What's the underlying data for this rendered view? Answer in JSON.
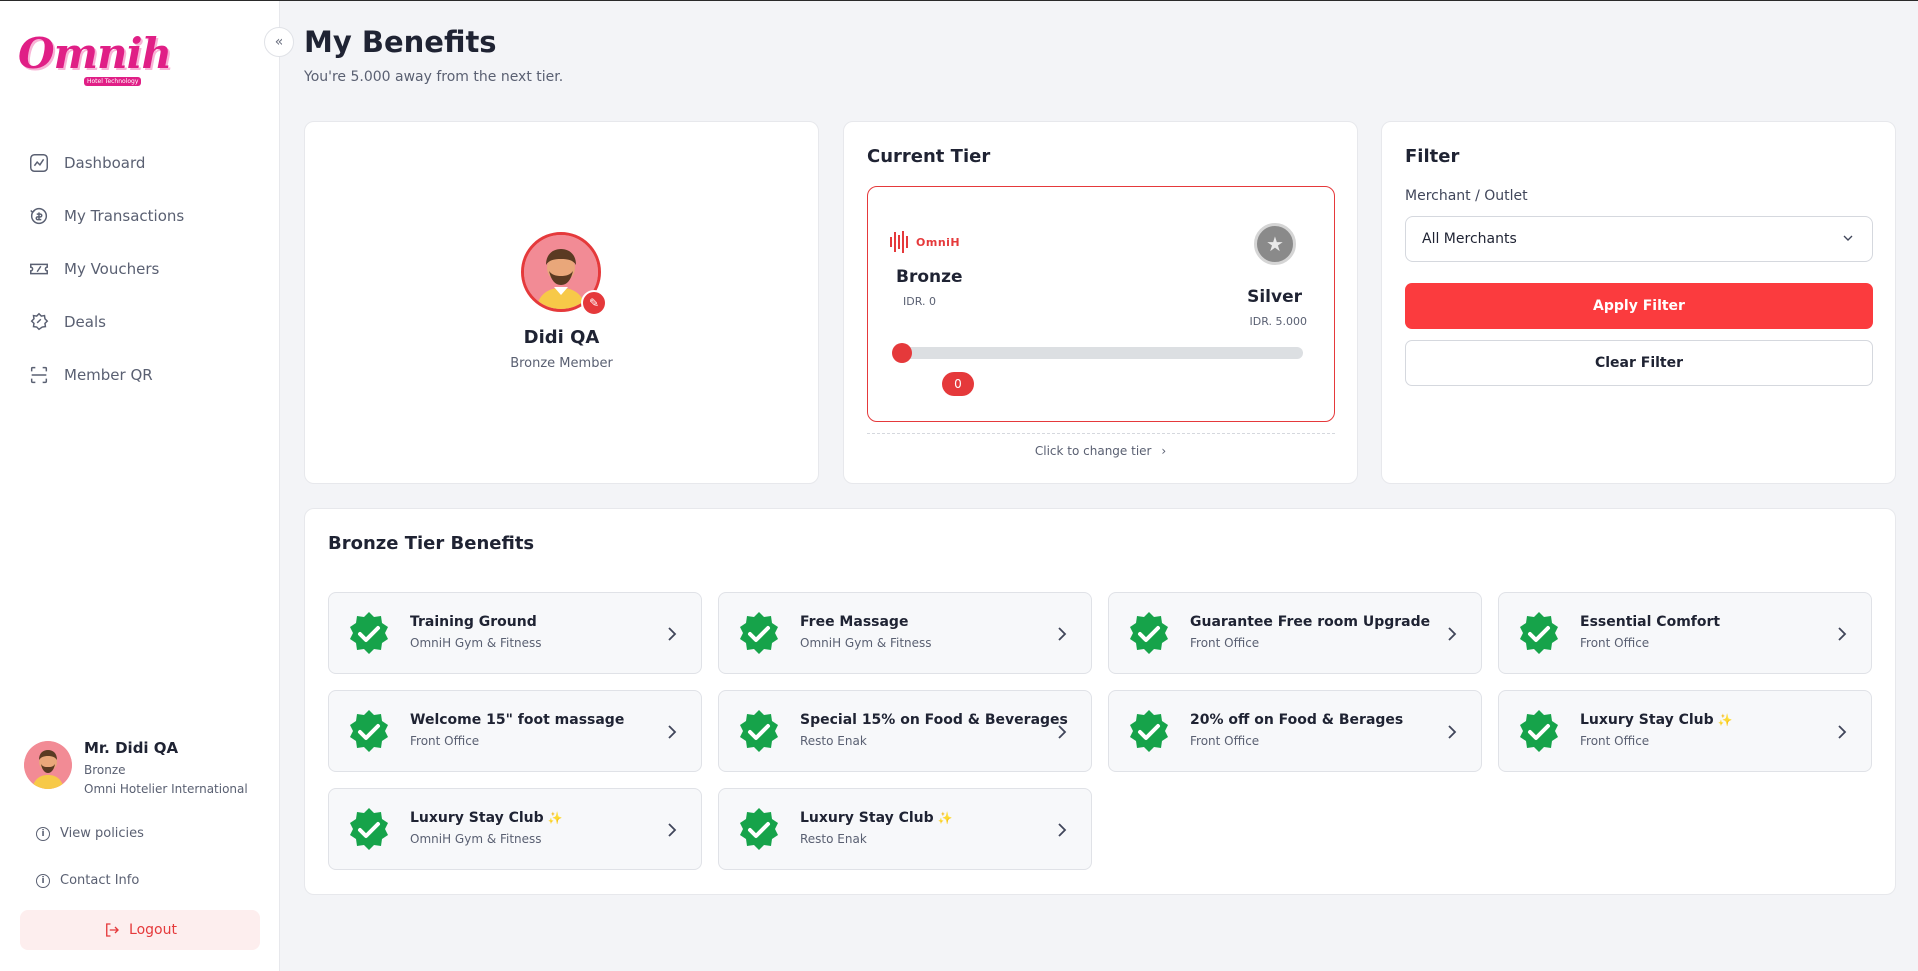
{
  "app": {
    "logo_text": "Omnih",
    "logo_subtext": "Hotel Technology",
    "collapse_label": "«"
  },
  "sidebar": {
    "nav": [
      {
        "label": "Dashboard",
        "icon": "chart-line-icon"
      },
      {
        "label": "My Transactions",
        "icon": "transactions-icon"
      },
      {
        "label": "My Vouchers",
        "icon": "voucher-icon"
      },
      {
        "label": "Deals",
        "icon": "deals-icon"
      },
      {
        "label": "Member QR",
        "icon": "qr-scan-icon"
      }
    ],
    "user": {
      "name": "Mr. Didi QA",
      "tier": "Bronze",
      "organization": "Omni Hotelier International"
    },
    "links": {
      "policies": "View policies",
      "contact": "Contact Info"
    },
    "logout_label": "Logout"
  },
  "header": {
    "title": "My Benefits",
    "subtitle": "You're 5.000 away from the next tier."
  },
  "profile": {
    "name": "Didi QA",
    "member_tier": "Bronze Member"
  },
  "current_tier": {
    "title": "Current Tier",
    "brand": "OmniH",
    "current": {
      "name": "Bronze",
      "amount": "IDR. 0"
    },
    "next": {
      "name": "Silver",
      "amount": "IDR. 5.000"
    },
    "progress_value": "0",
    "progress_fraction": 0,
    "change_label": "Click to change tier"
  },
  "filter": {
    "title": "Filter",
    "label": "Merchant / Outlet",
    "selected": "All Merchants",
    "apply_label": "Apply Filter",
    "clear_label": "Clear Filter"
  },
  "benefits": {
    "title": "Bronze Tier Benefits",
    "items": [
      {
        "title": "Training Ground",
        "subtitle": "OmniH Gym & Fitness",
        "sparkle": false
      },
      {
        "title": "Free Massage",
        "subtitle": "OmniH Gym & Fitness",
        "sparkle": false
      },
      {
        "title": "Guarantee Free room Upgrade",
        "subtitle": "Front Office",
        "sparkle": false
      },
      {
        "title": "Essential Comfort",
        "subtitle": "Front Office",
        "sparkle": false
      },
      {
        "title": "Welcome 15\" foot massage",
        "subtitle": "Front Office",
        "sparkle": false
      },
      {
        "title": "Special 15% on Food & Beverages",
        "subtitle": "Resto Enak",
        "sparkle": false
      },
      {
        "title": "20% off on Food & Berages",
        "subtitle": "Front Office",
        "sparkle": false
      },
      {
        "title": "Luxury Stay Club",
        "subtitle": "Front Office",
        "sparkle": true
      },
      {
        "title": "Luxury Stay Club",
        "subtitle": "OmniH Gym & Fitness",
        "sparkle": true
      },
      {
        "title": "Luxury Stay Club",
        "subtitle": "Resto Enak",
        "sparkle": true
      }
    ]
  },
  "colors": {
    "accent": "#fb3b3e",
    "brand": "#e01f86",
    "check": "#16a34a"
  }
}
